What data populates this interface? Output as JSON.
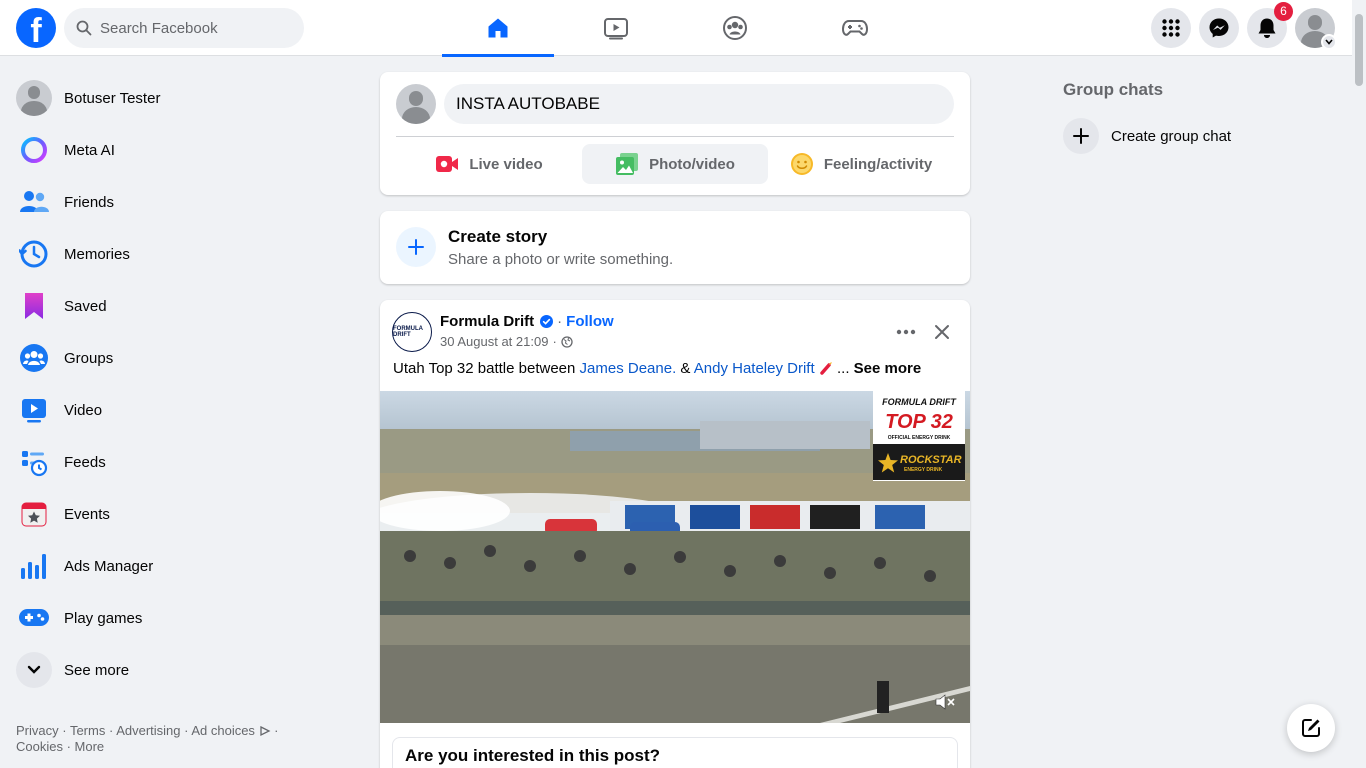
{
  "topbar": {
    "logo_letter": "f",
    "search_placeholder": "Search Facebook",
    "notification_count": "6",
    "tabs": [
      "home",
      "video",
      "groups",
      "gaming"
    ],
    "active_tab": "home"
  },
  "sidebar": {
    "items": [
      {
        "label": "Botuser Tester",
        "icon": "profile-avatar"
      },
      {
        "label": "Meta AI",
        "icon": "meta-ai-icon"
      },
      {
        "label": "Friends",
        "icon": "friends-icon"
      },
      {
        "label": "Memories",
        "icon": "memories-icon"
      },
      {
        "label": "Saved",
        "icon": "saved-icon"
      },
      {
        "label": "Groups",
        "icon": "groups-icon"
      },
      {
        "label": "Video",
        "icon": "video-icon"
      },
      {
        "label": "Feeds",
        "icon": "feeds-icon"
      },
      {
        "label": "Events",
        "icon": "events-icon"
      },
      {
        "label": "Ads Manager",
        "icon": "ads-manager-icon"
      },
      {
        "label": "Play games",
        "icon": "play-games-icon"
      },
      {
        "label": "See more",
        "icon": "chevron-down-icon"
      }
    ],
    "footer": {
      "privacy": "Privacy",
      "terms": "Terms",
      "advertising": "Advertising",
      "ad_choices": "Ad choices",
      "cookies": "Cookies",
      "more": "More"
    }
  },
  "composer": {
    "input_value": "INSTA AUTOBABE",
    "live_video": "Live video",
    "photo_video": "Photo/video",
    "feeling": "Feeling/activity"
  },
  "story": {
    "title": "Create story",
    "subtitle": "Share a photo or write something."
  },
  "post": {
    "author": "Formula Drift",
    "separator": "·",
    "follow": "Follow",
    "timestamp": "30 August at 21:09",
    "avatar_text": "FORMULA DRIFT",
    "text_prefix": "Utah Top 32 battle between ",
    "mention_1": "James Deane.",
    "text_mid": " & ",
    "mention_2": "Andy Hateley Drift",
    "text_suffix": " ... ",
    "see_more": "See more",
    "overlay": {
      "brand": "FORMULA DRIFT",
      "event": "TOP 32",
      "event_sub": "OFFICIAL ENERGY DRINK",
      "sponsor": "ROCKSTAR",
      "sponsor_sub": "ENERGY DRINK"
    },
    "interest_prompt": "Are you interested in this post?"
  },
  "right": {
    "group_chats_title": "Group chats",
    "create_group_chat": "Create group chat"
  },
  "colors": {
    "brand_blue": "#0866ff",
    "badge_red": "#e41e3f",
    "link_blue": "#0a58ca"
  }
}
